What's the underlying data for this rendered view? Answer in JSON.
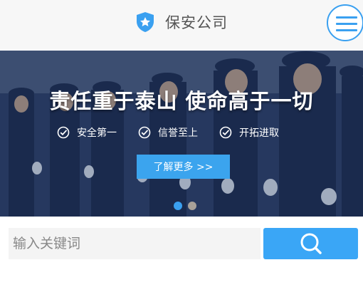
{
  "header": {
    "brand_name": "保安公司",
    "logo_icon": "shield-star-icon",
    "menu_icon": "hamburger-menu-icon",
    "accent_color": "#3aa0f0"
  },
  "banner": {
    "headline": "责任重于泰山 使命高于一切",
    "features": [
      {
        "icon": "check-circle-icon",
        "label": "安全第一"
      },
      {
        "icon": "check-circle-icon",
        "label": "信誉至上"
      },
      {
        "icon": "check-circle-icon",
        "label": "开拓进取"
      }
    ],
    "cta_label": "了解更多  >>",
    "cta_color": "#3ba4ee",
    "slide_count": 2,
    "active_slide": 1
  },
  "search": {
    "placeholder": "输入关键词",
    "value": "",
    "button_icon": "search-icon",
    "button_color": "#3aa6f6"
  }
}
